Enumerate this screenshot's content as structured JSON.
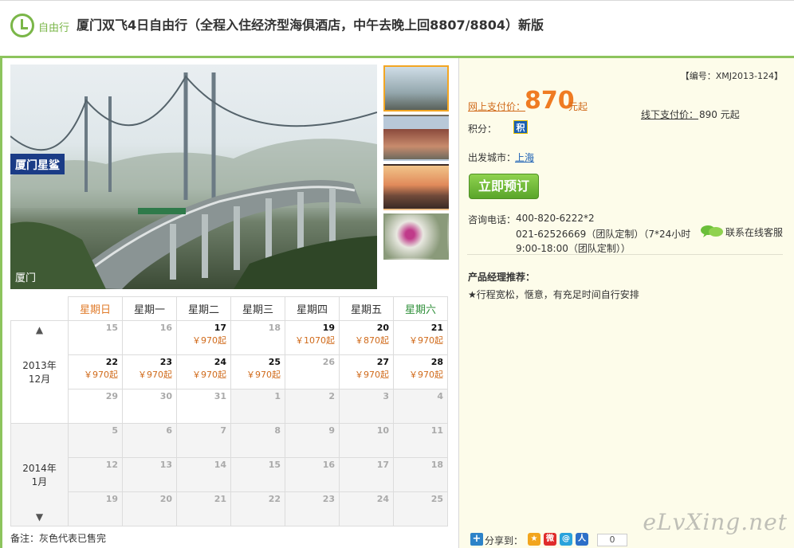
{
  "header": {
    "badge_label": "自由行",
    "title": "厦门双飞4日自由行（全程入住经济型海俱酒店，中午去晚上回8807/8804）新版"
  },
  "gallery": {
    "main_caption": "厦门",
    "main_sign": "厦门星鲨",
    "thumbnails": [
      "thumb-bridge",
      "thumb-building",
      "thumb-sunset-harbor",
      "thumb-flower"
    ],
    "active_thumbnail": 0
  },
  "calendar": {
    "weekdays": [
      "星期日",
      "星期一",
      "星期二",
      "星期三",
      "星期四",
      "星期五",
      "星期六"
    ],
    "months": [
      {
        "label": "2013年\n12月",
        "year": "2013年",
        "month": "12月"
      },
      {
        "label": "2014年\n1月",
        "year": "2014年",
        "month": "1月"
      }
    ],
    "up_arrow": "▲",
    "down_arrow": "▼",
    "weeks": [
      [
        {
          "n": "15"
        },
        {
          "n": "16"
        },
        {
          "n": "17",
          "p": "￥970起"
        },
        {
          "n": "18"
        },
        {
          "n": "19",
          "p": "￥1070起"
        },
        {
          "n": "20",
          "p": "￥870起"
        },
        {
          "n": "21",
          "p": "￥970起"
        }
      ],
      [
        {
          "n": "22",
          "p": "￥970起"
        },
        {
          "n": "23",
          "p": "￥970起"
        },
        {
          "n": "24",
          "p": "￥970起"
        },
        {
          "n": "25",
          "p": "￥970起"
        },
        {
          "n": "26"
        },
        {
          "n": "27",
          "p": "￥970起"
        },
        {
          "n": "28",
          "p": "￥970起"
        }
      ],
      [
        {
          "n": "29"
        },
        {
          "n": "30"
        },
        {
          "n": "31"
        },
        {
          "n": "1",
          "g": true
        },
        {
          "n": "2",
          "g": true
        },
        {
          "n": "3",
          "g": true
        },
        {
          "n": "4",
          "g": true
        }
      ],
      [
        {
          "n": "5",
          "g": true
        },
        {
          "n": "6",
          "g": true
        },
        {
          "n": "7",
          "g": true
        },
        {
          "n": "8",
          "g": true
        },
        {
          "n": "9",
          "g": true
        },
        {
          "n": "10",
          "g": true
        },
        {
          "n": "11",
          "g": true
        }
      ],
      [
        {
          "n": "12",
          "g": true
        },
        {
          "n": "13",
          "g": true
        },
        {
          "n": "14",
          "g": true
        },
        {
          "n": "15",
          "g": true
        },
        {
          "n": "16",
          "g": true
        },
        {
          "n": "17",
          "g": true
        },
        {
          "n": "18",
          "g": true
        }
      ],
      [
        {
          "n": "19",
          "g": true
        },
        {
          "n": "20",
          "g": true
        },
        {
          "n": "21",
          "g": true
        },
        {
          "n": "22",
          "g": true
        },
        {
          "n": "23",
          "g": true
        },
        {
          "n": "24",
          "g": true
        },
        {
          "n": "25",
          "g": true
        }
      ]
    ],
    "note": "备注：灰色代表已售完"
  },
  "info": {
    "code": "【编号：XMJ2013-124】",
    "online_label": "网上支付价：",
    "price": "870",
    "price_unit": "元起",
    "offline_label": "线下支付价：",
    "offline_price": "890 元起",
    "points_label": "积分：",
    "points_icon": "积",
    "depart_label": "出发城市：",
    "depart_city": "上海",
    "book_button": "立即预订",
    "tel_label": "咨询电话：",
    "tel_lines": [
      "400-820-6222*2",
      "021-62526669（团队定制）（7*24小时",
      "9:00-18:00（团队定制））"
    ],
    "chat_label": "联系在线客服",
    "rec_title": "产品经理推荐：",
    "rec_item": "★行程宽松，惬意，有充足时间自行安排",
    "share_label": "分享到：",
    "share_count": "0",
    "watermark": "eLvXing.net"
  },
  "colors": {
    "accent_green": "#8dc45d",
    "price_orange": "#ef7b22",
    "link_blue": "#1a5fb4"
  }
}
